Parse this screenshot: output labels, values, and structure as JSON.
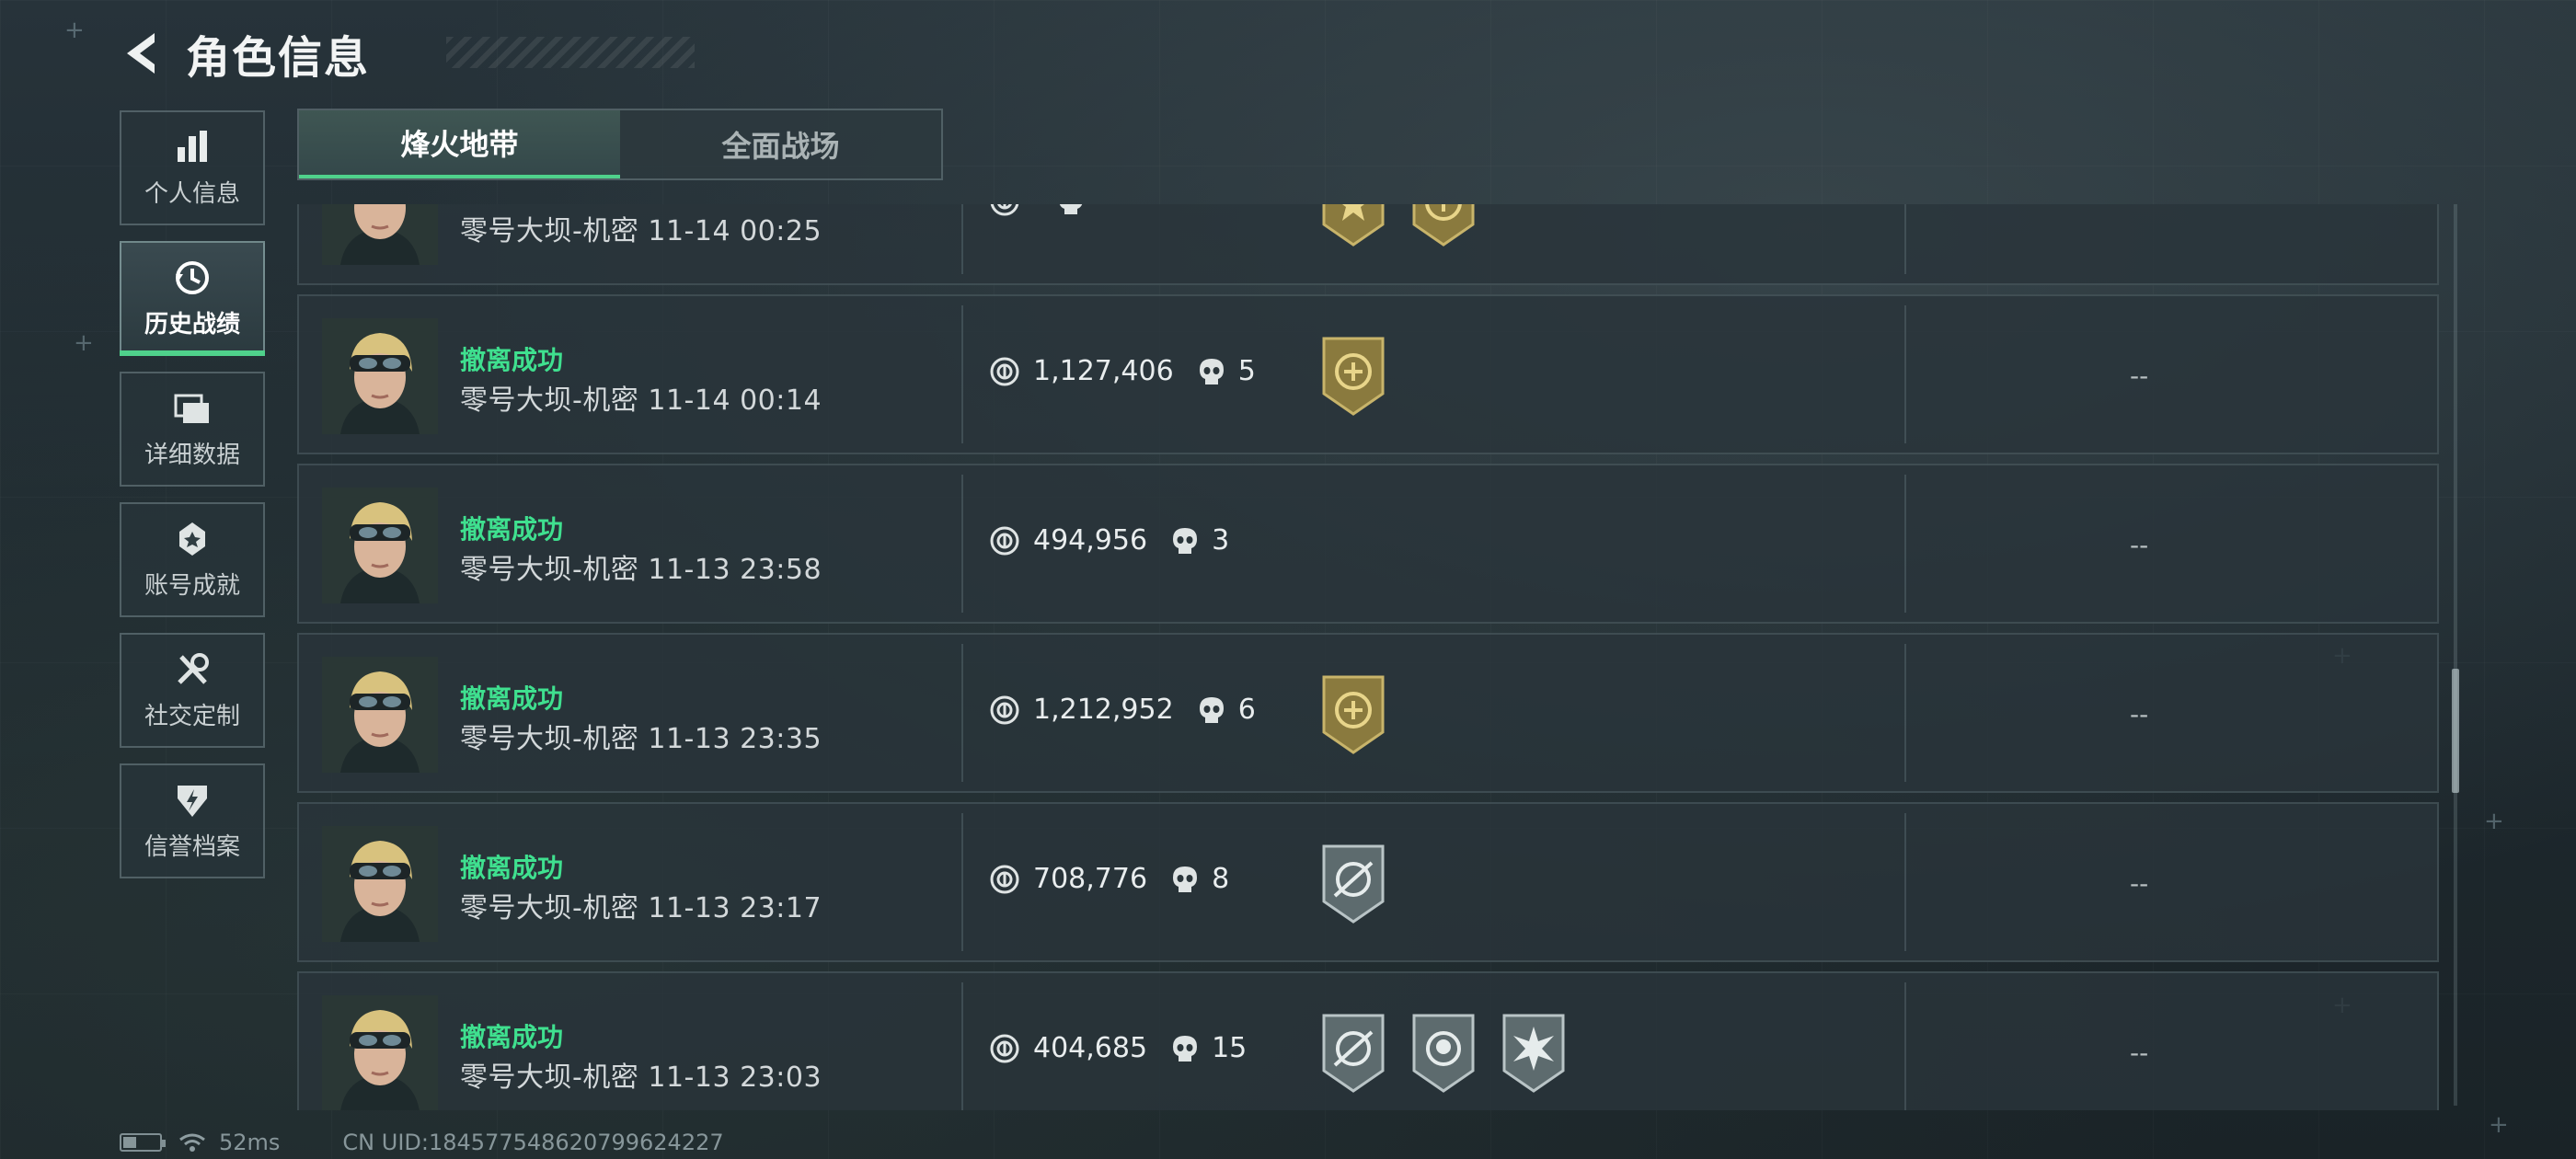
{
  "header": {
    "title": "角色信息"
  },
  "sidebar": {
    "items": [
      {
        "label": "个人信息",
        "icon": "bar-chart-icon"
      },
      {
        "label": "历史战绩",
        "icon": "clock-history-icon",
        "active": true
      },
      {
        "label": "详细数据",
        "icon": "folders-icon"
      },
      {
        "label": "账号成就",
        "icon": "medal-icon"
      },
      {
        "label": "社交定制",
        "icon": "tools-icon"
      },
      {
        "label": "信誉档案",
        "icon": "shield-bolt-icon"
      }
    ]
  },
  "tabs": [
    {
      "label": "烽火地带",
      "active": true
    },
    {
      "label": "全面战场",
      "active": false
    }
  ],
  "records": [
    {
      "status": "",
      "detail": "零号大坝-机密 11-14 00:25",
      "value": "",
      "kills": "",
      "badges": [
        "gold-star",
        "gold-emblem"
      ],
      "extra": ""
    },
    {
      "status": "撤离成功",
      "detail": "零号大坝-机密 11-14 00:14",
      "value": "1,127,406",
      "kills": "5",
      "badges": [
        "gold-emblem"
      ],
      "extra": "--"
    },
    {
      "status": "撤离成功",
      "detail": "零号大坝-机密 11-13 23:58",
      "value": "494,956",
      "kills": "3",
      "badges": [],
      "extra": "--"
    },
    {
      "status": "撤离成功",
      "detail": "零号大坝-机密 11-13 23:35",
      "value": "1,212,952",
      "kills": "6",
      "badges": [
        "gold-emblem"
      ],
      "extra": "--"
    },
    {
      "status": "撤离成功",
      "detail": "零号大坝-机密 11-13 23:17",
      "value": "708,776",
      "kills": "8",
      "badges": [
        "silver-crosshair"
      ],
      "extra": "--"
    },
    {
      "status": "撤离成功",
      "detail": "零号大坝-机密 11-13 23:03",
      "value": "404,685",
      "kills": "15",
      "badges": [
        "silver-crosshair",
        "silver-skull",
        "silver-burst"
      ],
      "extra": "--"
    }
  ],
  "footer": {
    "ping": "52ms",
    "uid": "CN UID:1845775486207996242​27"
  },
  "colors": {
    "accent": "#4fd18b",
    "success_text": "#3fe08f"
  }
}
